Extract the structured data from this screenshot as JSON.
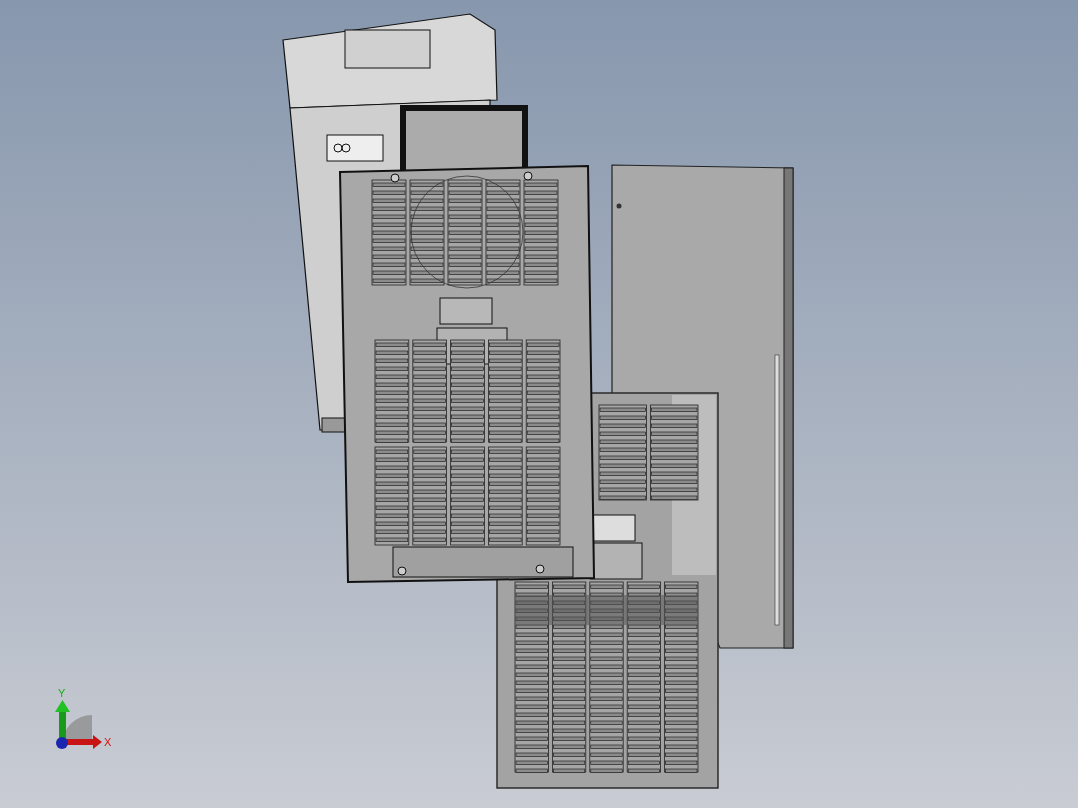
{
  "triad": {
    "x_label": "X",
    "y_label": "Y"
  }
}
